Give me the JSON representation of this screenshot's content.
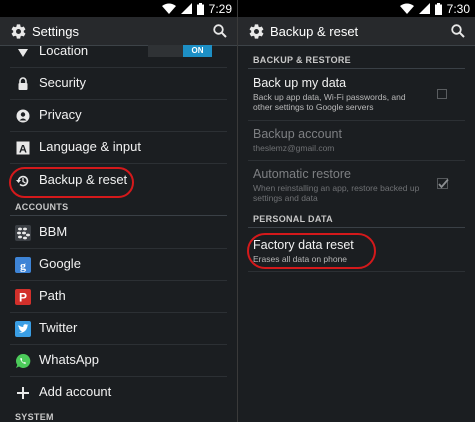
{
  "status": {
    "left_time": "7:29",
    "right_time": "7:30"
  },
  "left": {
    "title": "Settings",
    "items": [
      {
        "label": "Location",
        "toggle": "ON"
      },
      {
        "label": "Security"
      },
      {
        "label": "Privacy"
      },
      {
        "label": "Language & input"
      },
      {
        "label": "Backup & reset"
      }
    ],
    "accounts_header": "ACCOUNTS",
    "accounts": [
      {
        "label": "BBM"
      },
      {
        "label": "Google"
      },
      {
        "label": "Path"
      },
      {
        "label": "Twitter"
      },
      {
        "label": "WhatsApp"
      },
      {
        "label": "Add account"
      }
    ],
    "system_header": "SYSTEM"
  },
  "right": {
    "title": "Backup & reset",
    "backup_header": "BACKUP & RESTORE",
    "backup_data": {
      "title": "Back up my data",
      "subtitle": "Back up app data, Wi-Fi passwords, and other settings to Google servers"
    },
    "backup_account": {
      "title": "Backup account",
      "subtitle": "theslemz@gmail.com"
    },
    "auto_restore": {
      "title": "Automatic restore",
      "subtitle": "When reinstalling an app, restore backed up settings and data"
    },
    "personal_header": "PERSONAL DATA",
    "factory_reset": {
      "title": "Factory data reset",
      "subtitle": "Erases all data on phone"
    }
  },
  "colors": {
    "accent": "#1d8fc5",
    "highlight": "#d4191b",
    "background": "#1b1e21"
  }
}
